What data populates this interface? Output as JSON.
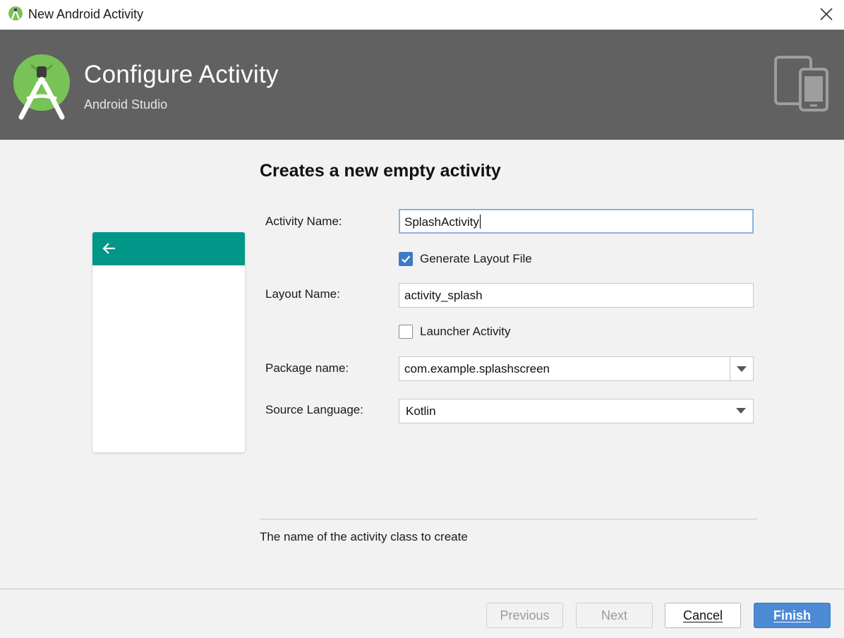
{
  "window": {
    "title": "New Android Activity"
  },
  "header": {
    "title": "Configure Activity",
    "subtitle": "Android Studio"
  },
  "main": {
    "section_title": "Creates a new empty activity",
    "activity_name": {
      "label": "Activity Name:",
      "value": "SplashActivity"
    },
    "generate_layout": {
      "label": "Generate Layout File",
      "checked": true
    },
    "layout_name": {
      "label": "Layout Name:",
      "value": "activity_splash"
    },
    "launcher_activity": {
      "label": "Launcher Activity",
      "checked": false
    },
    "package_name": {
      "label": "Package name:",
      "value": "com.example.splashscreen"
    },
    "source_language": {
      "label": "Source Language:",
      "value": "Kotlin"
    },
    "hint": "The name of the activity class to create"
  },
  "footer": {
    "previous_label": "Previous",
    "next_label": "Next",
    "cancel_label": "Cancel",
    "finish_label": "Finish"
  },
  "colors": {
    "header_bg": "#616161",
    "appbar": "#009688",
    "accent": "#4d8ad4",
    "android_green": "#78c257"
  },
  "icons": {
    "app": "android-studio-icon",
    "close": "close-icon",
    "logo": "android-studio-logo-icon",
    "devices": "devices-icon",
    "back": "arrow-back-icon",
    "dropdown": "chevron-down-icon",
    "check": "checkmark-icon"
  }
}
